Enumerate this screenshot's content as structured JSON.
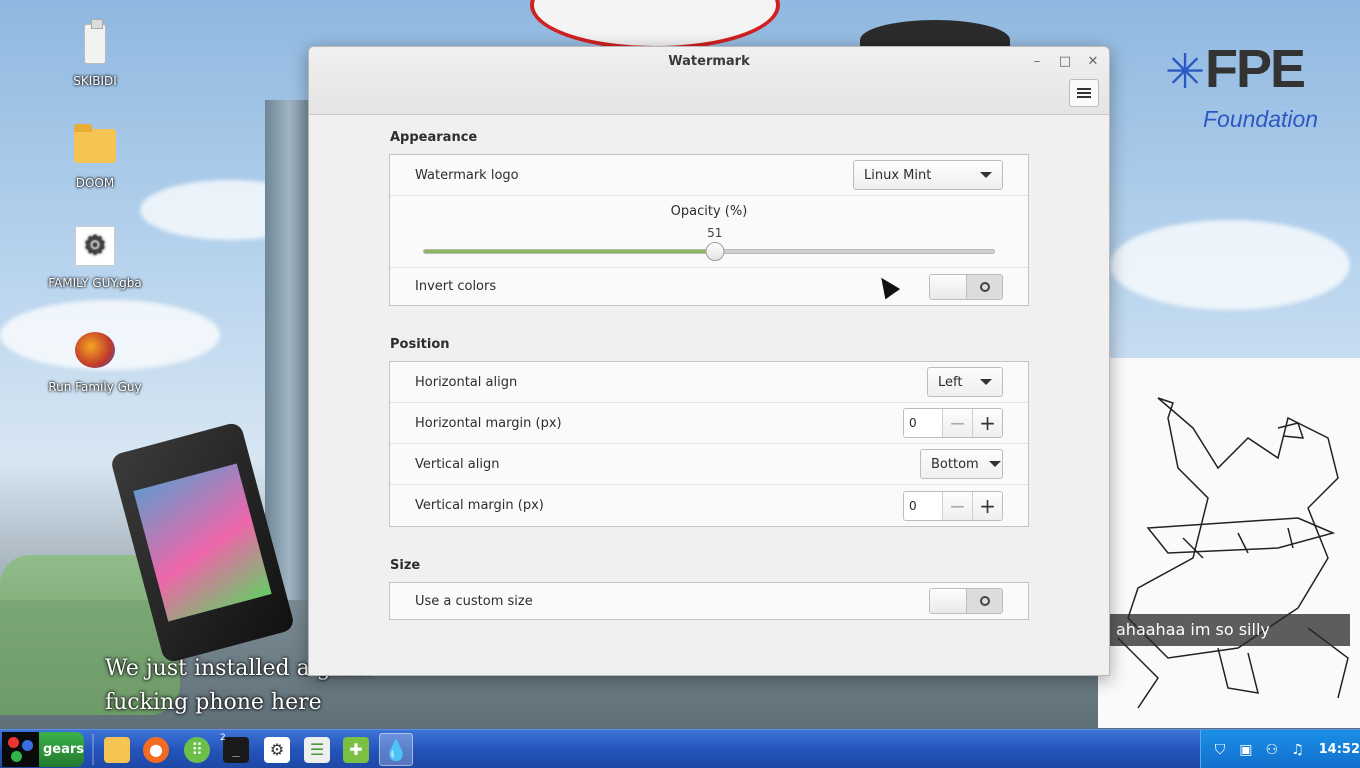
{
  "desktop": {
    "icons": [
      {
        "label": "SKIBIDI",
        "icon": "usb-drive-icon"
      },
      {
        "label": "DOOM",
        "icon": "folder-icon"
      },
      {
        "label": "FAMILY GUY.gba",
        "icon": "settings-gear-icon"
      },
      {
        "label": "Run Family Guy",
        "icon": "family-guy-icon"
      }
    ],
    "wallpaper": {
      "fpe_logo": "FPE",
      "fpe_foundation": "Foundation",
      "meme_line1": "We just installed a giant",
      "meme_line2": "fucking phone here",
      "caption": "ahaahaa im so silly"
    }
  },
  "window": {
    "title": "Watermark",
    "controls": {
      "minimize": "–",
      "maximize": "□",
      "close": "✕"
    },
    "sections": {
      "appearance": {
        "title": "Appearance",
        "watermark_logo_label": "Watermark logo",
        "watermark_logo_value": "Linux Mint",
        "opacity_label": "Opacity (%)",
        "opacity_value": "51",
        "opacity_fraction": 0.51,
        "invert_colors_label": "Invert colors",
        "invert_colors_on": false
      },
      "position": {
        "title": "Position",
        "horizontal_align_label": "Horizontal align",
        "horizontal_align_value": "Left",
        "horizontal_margin_label": "Horizontal margin (px)",
        "horizontal_margin_value": "0",
        "vertical_align_label": "Vertical align",
        "vertical_align_value": "Bottom",
        "vertical_margin_label": "Vertical margin (px)",
        "vertical_margin_value": "0"
      },
      "size": {
        "title": "Size",
        "custom_size_label": "Use a custom size",
        "custom_size_on": false
      }
    }
  },
  "taskbar": {
    "start_label": "gears",
    "terminal_badge": "2",
    "clock": "14:52"
  },
  "colors": {
    "accent_green": "#8cb85c",
    "taskbar_blue": "#2353b8",
    "tray_blue": "#116fcc"
  }
}
